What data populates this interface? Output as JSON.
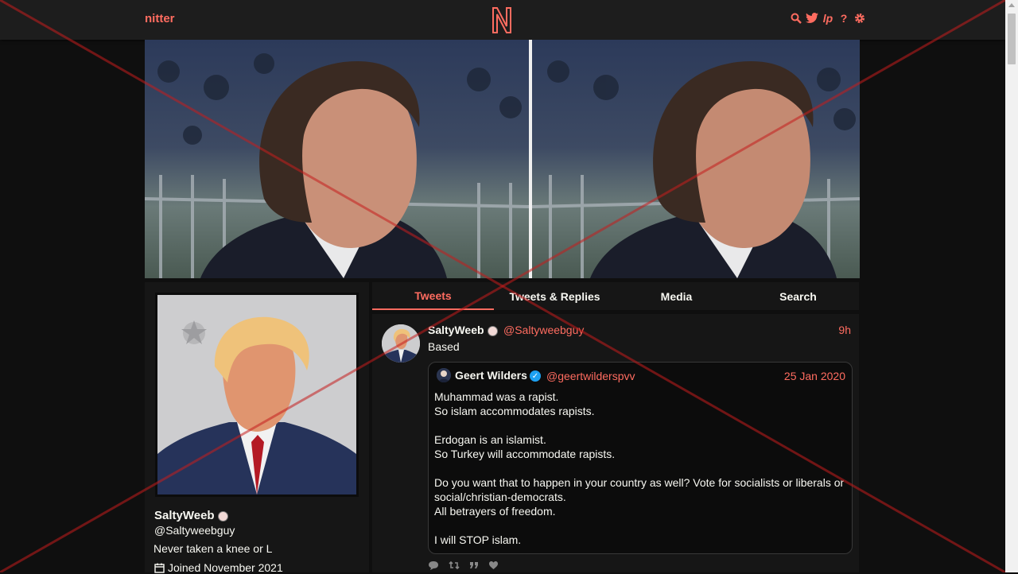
{
  "navbar": {
    "brand": "nitter",
    "logo_letter": "N",
    "icons": [
      "search-icon",
      "twitter-icon",
      "lp-icon",
      "help-icon",
      "gear-icon"
    ],
    "lp_label": "lp",
    "help_label": "?"
  },
  "profile": {
    "display_name": "SaltyWeeb",
    "username": "@Saltyweebguy",
    "bio": "Never taken a knee or L",
    "joined": "Joined November 2021"
  },
  "tabs": [
    {
      "label": "Tweets",
      "active": true
    },
    {
      "label": "Tweets & Replies",
      "active": false
    },
    {
      "label": "Media",
      "active": false
    },
    {
      "label": "Search",
      "active": false
    }
  ],
  "tweet": {
    "display_name": "SaltyWeeb",
    "username": "@Saltyweebguy",
    "time": "9h",
    "text": "Based",
    "quote": {
      "display_name": "Geert Wilders",
      "verified_mark": "✓",
      "username": "@geertwilderspvv",
      "date": "25 Jan 2020",
      "lines": [
        "Muhammad was a rapist.",
        "So islam accommodates rapists.",
        "",
        "Erdogan is an islamist.",
        "So Turkey will accommodate rapists.",
        "",
        "Do you want that to happen in your country as well? Vote for socialists or liberals or social/christian-democrats.",
        "All betrayers of freedom.",
        "",
        "I will STOP islam."
      ]
    }
  },
  "colors": {
    "accent": "#ff6c60",
    "background": "#0f0f0f",
    "panel": "#161616",
    "navbar": "#1d1d1d",
    "text": "#f8f8f2",
    "verified": "#1da1f2"
  }
}
